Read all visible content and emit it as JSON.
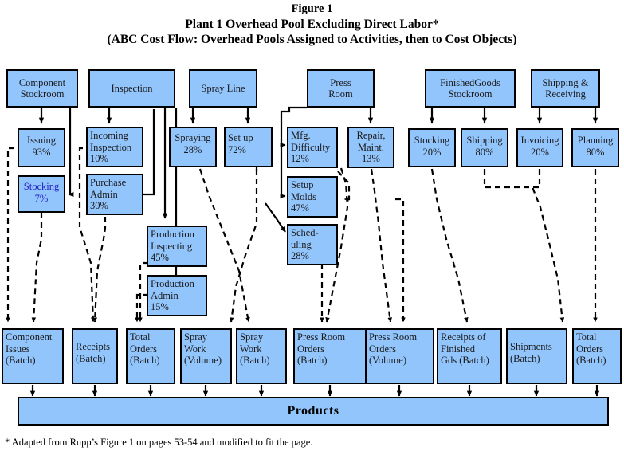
{
  "figure": {
    "title_line1": "Figure 1",
    "title_line2": "Plant 1 Overhead Pool Excluding Direct Labor*",
    "title_line3": "(ABC Cost Flow: Overhead Pools Assigned to Activities, then to Cost Objects)",
    "footnote": "* Adapted from Rupp’s Figure 1 on pages  53-54 and modified to fit the page.",
    "colors": {
      "box_fill": "#93C5FD",
      "box_border": "#000000",
      "text": "#000000",
      "highlight_text": "#2020c0",
      "background": "#ffffff"
    }
  },
  "overhead_pools": [
    {
      "id": "component-stockroom",
      "label": "Component\nStockroom"
    },
    {
      "id": "inspection",
      "label": "Inspection"
    },
    {
      "id": "spray-line",
      "label": "Spray Line"
    },
    {
      "id": "press-room",
      "label": "Press\nRoom"
    },
    {
      "id": "finished-goods-stockroom",
      "label": "FinishedGoods\nStockroom"
    },
    {
      "id": "shipping-receiving",
      "label": "Shipping &\nReceiving"
    }
  ],
  "activities": [
    {
      "id": "issuing",
      "name": "Issuing",
      "percent": "93%",
      "label": "Issuing\n93%"
    },
    {
      "id": "stocking-component",
      "name": "Stocking",
      "percent": "7%",
      "label": "Stocking\n7%"
    },
    {
      "id": "incoming-inspection",
      "name": "Incoming Inspection",
      "percent": "10%",
      "label": "Incoming\nInspection\n10%"
    },
    {
      "id": "purchase-admin",
      "name": "Purchase Admin",
      "percent": "30%",
      "label": "Purchase\nAdmin\n30%"
    },
    {
      "id": "production-inspecting",
      "name": "Production Inspecting",
      "percent": "45%",
      "label": "Production\nInspecting\n45%"
    },
    {
      "id": "production-admin",
      "name": "Production Admin",
      "percent": "15%",
      "label": "Production\nAdmin\n15%"
    },
    {
      "id": "spraying",
      "name": "Spraying",
      "percent": "28%",
      "label": "Spraying\n28%"
    },
    {
      "id": "set-up",
      "name": "Set up",
      "percent": "72%",
      "label": "Set up\n72%"
    },
    {
      "id": "mfg-difficulty",
      "name": "Mfg. Difficulty",
      "percent": "12%",
      "label": "Mfg.\nDifficulty\n12%"
    },
    {
      "id": "setup-molds",
      "name": "Setup Molds",
      "percent": "47%",
      "label": "Setup\nMolds\n47%"
    },
    {
      "id": "scheduling",
      "name": "Scheduling",
      "percent": "28%",
      "label": "Sched-\nuling\n28%"
    },
    {
      "id": "repair-maint",
      "name": "Repair, Maint.",
      "percent": "13%",
      "label": "Repair,\nMaint.\n13%"
    },
    {
      "id": "stocking-fg",
      "name": "Stocking",
      "percent": "20%",
      "label": "Stocking\n20%"
    },
    {
      "id": "shipping",
      "name": "Shipping",
      "percent": "80%",
      "label": "Shipping\n80%"
    },
    {
      "id": "invoicing",
      "name": "Invoicing",
      "percent": "20%",
      "label": "Invoicing\n20%"
    },
    {
      "id": "planning",
      "name": "Planning",
      "percent": "80%",
      "label": "Planning\n80%"
    }
  ],
  "cost_drivers": [
    {
      "id": "component-issues",
      "label": "Component\nIssues\n(Batch)"
    },
    {
      "id": "receipts",
      "label": "Receipts\n(Batch)"
    },
    {
      "id": "total-orders-left",
      "label": "Total\nOrders\n(Batch)"
    },
    {
      "id": "spray-work-volume",
      "label": "Spray\nWork\n(Volume)"
    },
    {
      "id": "spray-work-batch",
      "label": "Spray\nWork\n(Batch)"
    },
    {
      "id": "press-room-orders-batch",
      "label": "Press Room\nOrders\n(Batch)"
    },
    {
      "id": "press-room-orders-volume",
      "label": "Press Room\nOrders\n(Volume)"
    },
    {
      "id": "receipts-finished-gds",
      "label": "Receipts of\nFinished\nGds (Batch)"
    },
    {
      "id": "shipments",
      "label": "Shipments\n(Batch)"
    },
    {
      "id": "total-orders-right",
      "label": "Total\nOrders\n(Batch)"
    }
  ],
  "cost_object": {
    "id": "products",
    "label": "Products"
  }
}
